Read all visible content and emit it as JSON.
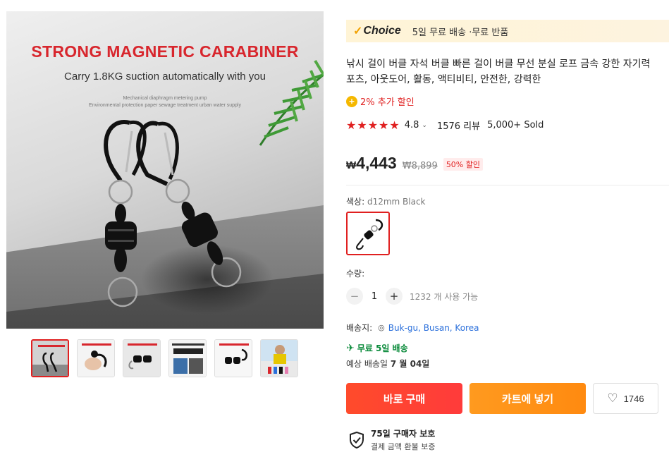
{
  "gallery": {
    "image_headline": "STRONG MAGNETIC CARABINER",
    "image_subheadline": "Carry 1.8KG suction automatically with you",
    "image_small_line1": "Mechanical diaphragm metering pump",
    "image_small_line2": "Environmental protection paper sewage treatment urban water supply",
    "thumbnail_count": 6,
    "active_thumbnail": 0
  },
  "choice": {
    "logo": "Choice",
    "text": "5일 무료 배송 ·무료 반품",
    "accent": "#f2a100"
  },
  "product": {
    "title": "낚시 걸이 버클 자석 버클 빠른 걸이 버클 무선 분실 로프 금속 강한 자기력\n포츠, 아웃도어, 활동, 액티비티, 안전한, 강력한",
    "coupon": "2% 추가 할인",
    "rating": "4.8",
    "stars": "★★★★★",
    "reviews": "1576 리뷰",
    "sold": "5,000+ Sold",
    "price_currency": "₩",
    "price": "4,443",
    "original_price": "₩8,899",
    "discount": "50% 할인"
  },
  "variant": {
    "label": "색상: ",
    "value": "d12mm Black"
  },
  "quantity": {
    "label": "수량:",
    "minus": "−",
    "value": "1",
    "plus": "+",
    "available": "1232 개 사용 가능"
  },
  "shipping": {
    "label": "배송지:",
    "location": "Buk-gu, Busan, Korea",
    "free": "무료 5일 배송",
    "eta_prefix": "예상 배송일 ",
    "eta_date": "7 월 04일"
  },
  "actions": {
    "buy": "바로 구매",
    "cart": "카트에 넣기",
    "wishlist_count": "1746"
  },
  "protection": {
    "title": "75일 구매자 보호",
    "subtitle": "결제 금액 환불 보증"
  },
  "colors": {
    "accent_red": "#e02020",
    "buy_button": "#ff4b2b",
    "cart_button": "#ff8a10",
    "free_ship_green": "#0a8a3a",
    "link_blue": "#2a6fdb"
  }
}
